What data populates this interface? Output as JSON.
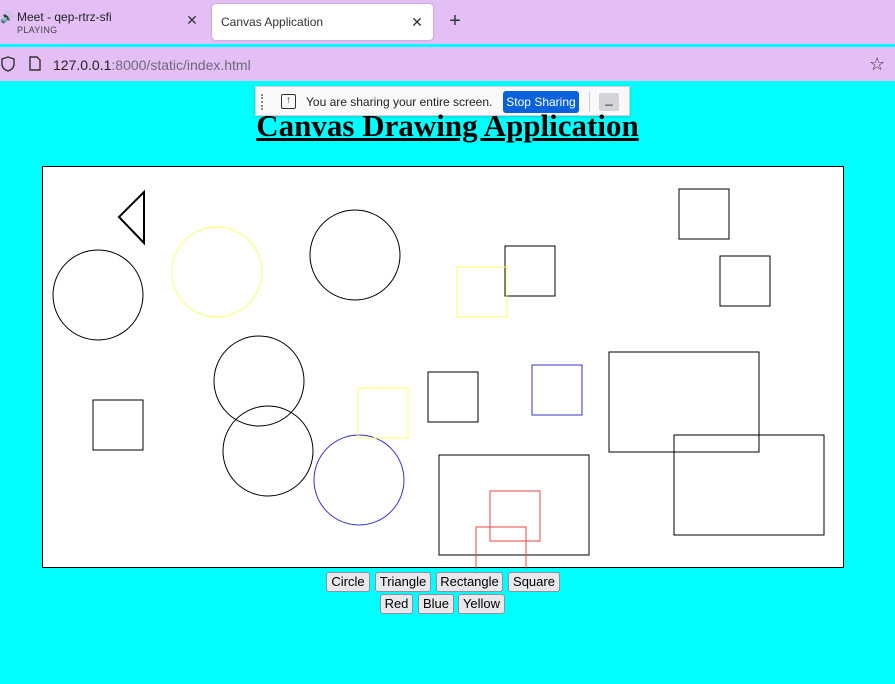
{
  "browser": {
    "tabs": [
      {
        "title": "Meet - qep-rtrz-sfi",
        "subtitle": "PLAYING"
      },
      {
        "title": "Canvas Application"
      }
    ],
    "url_host": "127.0.0.1",
    "url_rest": ":8000/static/index.html"
  },
  "sharing": {
    "message": "You are sharing your entire screen.",
    "stop_label": "Stop Sharing",
    "minimize_label": "_"
  },
  "page": {
    "title": "Canvas Drawing Application"
  },
  "shape_buttons": [
    "Circle",
    "Triangle",
    "Rectangle",
    "Square"
  ],
  "color_buttons": [
    "Red",
    "Blue",
    "Yellow"
  ],
  "colors": {
    "black": "#000000",
    "yellow": "#ffff66",
    "blue": "#3333cc",
    "red": "#ee4444",
    "background": "#00ffff",
    "bar": "#e3bff6"
  }
}
